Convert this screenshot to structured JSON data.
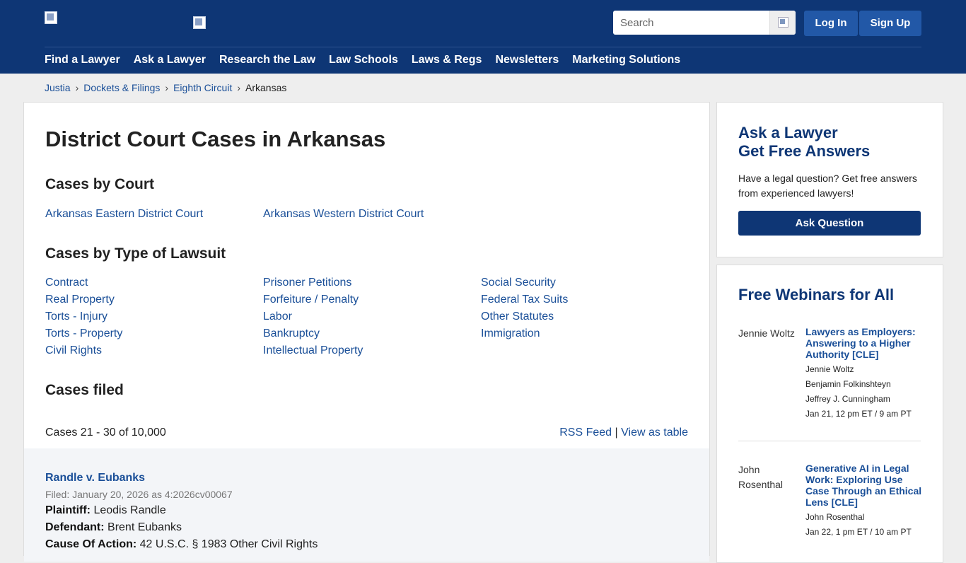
{
  "header": {
    "search_placeholder": "Search",
    "login_label": "Log In",
    "signup_label": "Sign Up",
    "colors": {
      "header_bg": "#0e3675",
      "button_bg": "#2258a7"
    }
  },
  "nav": [
    {
      "label": "Find a Lawyer"
    },
    {
      "label": "Ask a Lawyer"
    },
    {
      "label": "Research the Law"
    },
    {
      "label": "Law Schools"
    },
    {
      "label": "Laws & Regs"
    },
    {
      "label": "Newsletters"
    },
    {
      "label": "Marketing Solutions"
    }
  ],
  "breadcrumb": {
    "items": [
      "Justia",
      "Dockets & Filings",
      "Eighth Circuit"
    ],
    "current": "Arkansas",
    "separator": "›"
  },
  "main": {
    "title": "District Court Cases in Arkansas",
    "courts_heading": "Cases by Court",
    "courts": [
      "Arkansas Eastern District Court",
      "Arkansas Western District Court"
    ],
    "types_heading": "Cases by Type of Lawsuit",
    "types": {
      "col1": [
        "Contract",
        "Real Property",
        "Torts - Injury",
        "Torts - Property",
        "Civil Rights"
      ],
      "col2": [
        "Prisoner Petitions",
        "Forfeiture / Penalty",
        "Labor",
        "Bankruptcy",
        "Intellectual Property"
      ],
      "col3": [
        "Social Security",
        "Federal Tax Suits",
        "Other Statutes",
        "Immigration"
      ]
    },
    "filed_heading": "Cases filed",
    "cases_count": "Cases 21 - 30 of 10,000",
    "rss_label": "RSS Feed",
    "feed_sep": "|",
    "table_label": "View as table",
    "case": {
      "title": "Randle v. Eubanks",
      "filed": "Filed: January 20, 2026 as 4:2026cv00067",
      "plaintiff_label": "Plaintiff:",
      "plaintiff": "Leodis Randle",
      "defendant_label": "Defendant:",
      "defendant": "Brent Eubanks",
      "cause_label": "Cause Of Action:",
      "cause": "42 U.S.C. § 1983 Other Civil Rights"
    }
  },
  "sidebar": {
    "ask": {
      "title_line1": "Ask a Lawyer",
      "title_line2": "Get Free Answers",
      "text": "Have a legal question? Get free answers from experienced lawyers!",
      "button": "Ask Question"
    },
    "webinars": {
      "title": "Free Webinars for All",
      "items": [
        {
          "photo_alt": "Jennie Woltz",
          "title": "Lawyers as Employers: Answering to a Higher Authority [CLE]",
          "speakers": [
            "Jennie Woltz",
            "Benjamin Folkinshteyn",
            "Jeffrey J. Cunningham"
          ],
          "date": "Jan 21, 12 pm ET / 9 am PT"
        },
        {
          "photo_alt": "John Rosenthal",
          "title": "Generative AI in Legal Work: Exploring Use Case Through an Ethical Lens [CLE]",
          "speakers": [
            "John Rosenthal"
          ],
          "date": "Jan 22, 1 pm ET / 10 am PT"
        }
      ]
    }
  }
}
